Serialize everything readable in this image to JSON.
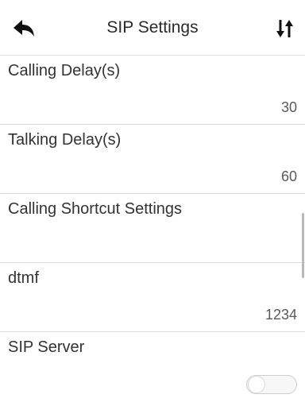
{
  "header": {
    "title": "SIP Settings",
    "back_icon": "back-arrow-icon",
    "sort_icon": "sort-arrows-icon"
  },
  "settings": [
    {
      "label": "Calling Delay(s)",
      "value": "30"
    },
    {
      "label": "Talking Delay(s)",
      "value": "60"
    },
    {
      "label": "Calling Shortcut Settings",
      "value": ""
    },
    {
      "label": "dtmf",
      "value": "1234"
    },
    {
      "label": "SIP Server",
      "toggle": false
    }
  ]
}
